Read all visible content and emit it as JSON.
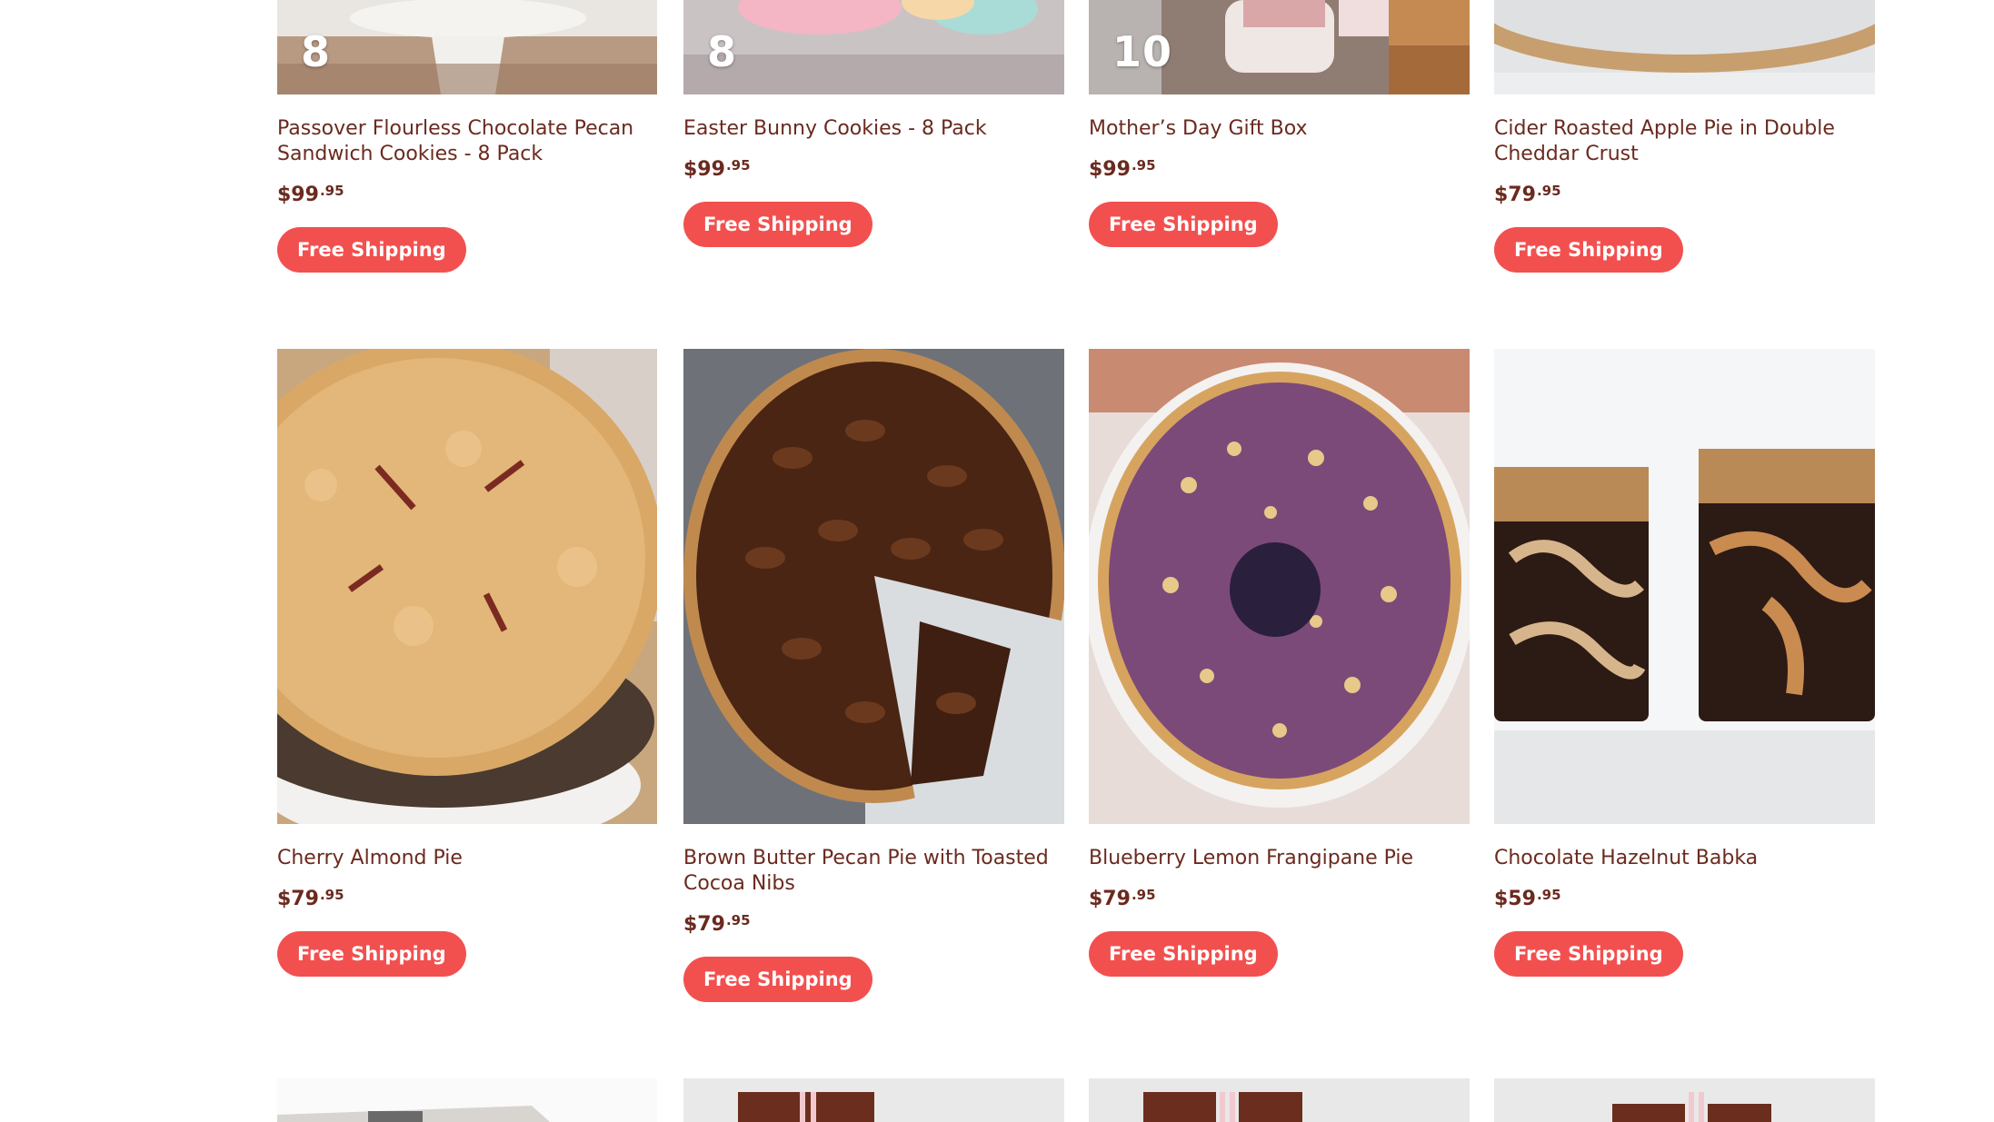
{
  "products": {
    "row1": [
      {
        "badge": "8",
        "title": "Passover Flourless Chocolate Pecan Sandwich Cookies - 8 Pack",
        "price_dollars": "$99",
        "price_cents": ".95",
        "shipping_label": "Free Shipping"
      },
      {
        "badge": "8",
        "title": "Easter Bunny Cookies - 8 Pack",
        "price_dollars": "$99",
        "price_cents": ".95",
        "shipping_label": "Free Shipping"
      },
      {
        "badge": "10",
        "title": "Mother’s Day Gift Box",
        "price_dollars": "$99",
        "price_cents": ".95",
        "shipping_label": "Free Shipping"
      },
      {
        "badge": "",
        "title": "Cider Roasted Apple Pie in Double Cheddar Crust",
        "price_dollars": "$79",
        "price_cents": ".95",
        "shipping_label": "Free Shipping"
      }
    ],
    "row2": [
      {
        "title": "Cherry Almond Pie",
        "price_dollars": "$79",
        "price_cents": ".95",
        "shipping_label": "Free Shipping"
      },
      {
        "title": "Brown Butter Pecan Pie with Toasted Cocoa Nibs",
        "price_dollars": "$79",
        "price_cents": ".95",
        "shipping_label": "Free Shipping"
      },
      {
        "title": "Blueberry Lemon Frangipane Pie",
        "price_dollars": "$79",
        "price_cents": ".95",
        "shipping_label": "Free Shipping"
      },
      {
        "title": "Chocolate Hazelnut Babka",
        "price_dollars": "$59",
        "price_cents": ".95",
        "shipping_label": "Free Shipping"
      }
    ]
  },
  "colors": {
    "accent": "#f2504f",
    "text": "#6b2a1f",
    "background": "#ffffff"
  }
}
